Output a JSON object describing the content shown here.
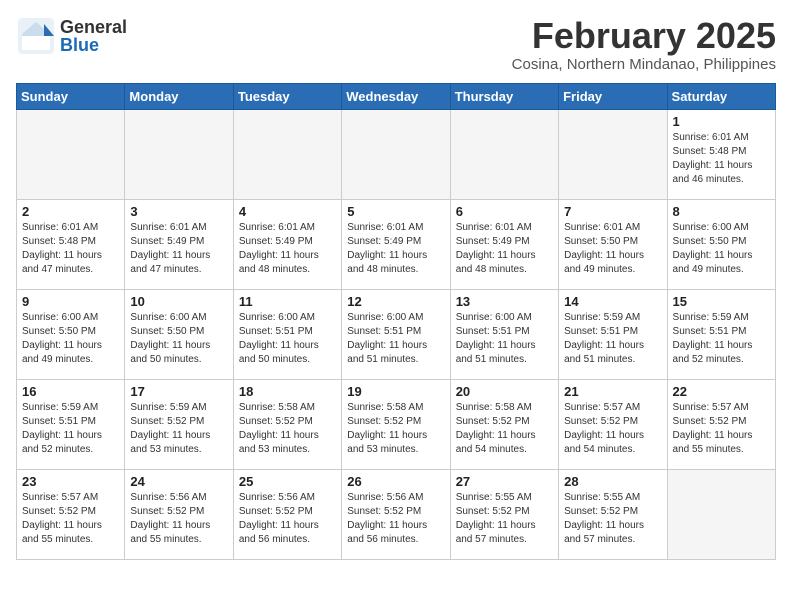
{
  "header": {
    "logo_general": "General",
    "logo_blue": "Blue",
    "month": "February 2025",
    "location": "Cosina, Northern Mindanao, Philippines"
  },
  "weekdays": [
    "Sunday",
    "Monday",
    "Tuesday",
    "Wednesday",
    "Thursday",
    "Friday",
    "Saturday"
  ],
  "weeks": [
    [
      {
        "day": "",
        "info": ""
      },
      {
        "day": "",
        "info": ""
      },
      {
        "day": "",
        "info": ""
      },
      {
        "day": "",
        "info": ""
      },
      {
        "day": "",
        "info": ""
      },
      {
        "day": "",
        "info": ""
      },
      {
        "day": "1",
        "info": "Sunrise: 6:01 AM\nSunset: 5:48 PM\nDaylight: 11 hours and 46 minutes."
      }
    ],
    [
      {
        "day": "2",
        "info": "Sunrise: 6:01 AM\nSunset: 5:48 PM\nDaylight: 11 hours and 47 minutes."
      },
      {
        "day": "3",
        "info": "Sunrise: 6:01 AM\nSunset: 5:49 PM\nDaylight: 11 hours and 47 minutes."
      },
      {
        "day": "4",
        "info": "Sunrise: 6:01 AM\nSunset: 5:49 PM\nDaylight: 11 hours and 48 minutes."
      },
      {
        "day": "5",
        "info": "Sunrise: 6:01 AM\nSunset: 5:49 PM\nDaylight: 11 hours and 48 minutes."
      },
      {
        "day": "6",
        "info": "Sunrise: 6:01 AM\nSunset: 5:49 PM\nDaylight: 11 hours and 48 minutes."
      },
      {
        "day": "7",
        "info": "Sunrise: 6:01 AM\nSunset: 5:50 PM\nDaylight: 11 hours and 49 minutes."
      },
      {
        "day": "8",
        "info": "Sunrise: 6:00 AM\nSunset: 5:50 PM\nDaylight: 11 hours and 49 minutes."
      }
    ],
    [
      {
        "day": "9",
        "info": "Sunrise: 6:00 AM\nSunset: 5:50 PM\nDaylight: 11 hours and 49 minutes."
      },
      {
        "day": "10",
        "info": "Sunrise: 6:00 AM\nSunset: 5:50 PM\nDaylight: 11 hours and 50 minutes."
      },
      {
        "day": "11",
        "info": "Sunrise: 6:00 AM\nSunset: 5:51 PM\nDaylight: 11 hours and 50 minutes."
      },
      {
        "day": "12",
        "info": "Sunrise: 6:00 AM\nSunset: 5:51 PM\nDaylight: 11 hours and 51 minutes."
      },
      {
        "day": "13",
        "info": "Sunrise: 6:00 AM\nSunset: 5:51 PM\nDaylight: 11 hours and 51 minutes."
      },
      {
        "day": "14",
        "info": "Sunrise: 5:59 AM\nSunset: 5:51 PM\nDaylight: 11 hours and 51 minutes."
      },
      {
        "day": "15",
        "info": "Sunrise: 5:59 AM\nSunset: 5:51 PM\nDaylight: 11 hours and 52 minutes."
      }
    ],
    [
      {
        "day": "16",
        "info": "Sunrise: 5:59 AM\nSunset: 5:51 PM\nDaylight: 11 hours and 52 minutes."
      },
      {
        "day": "17",
        "info": "Sunrise: 5:59 AM\nSunset: 5:52 PM\nDaylight: 11 hours and 53 minutes."
      },
      {
        "day": "18",
        "info": "Sunrise: 5:58 AM\nSunset: 5:52 PM\nDaylight: 11 hours and 53 minutes."
      },
      {
        "day": "19",
        "info": "Sunrise: 5:58 AM\nSunset: 5:52 PM\nDaylight: 11 hours and 53 minutes."
      },
      {
        "day": "20",
        "info": "Sunrise: 5:58 AM\nSunset: 5:52 PM\nDaylight: 11 hours and 54 minutes."
      },
      {
        "day": "21",
        "info": "Sunrise: 5:57 AM\nSunset: 5:52 PM\nDaylight: 11 hours and 54 minutes."
      },
      {
        "day": "22",
        "info": "Sunrise: 5:57 AM\nSunset: 5:52 PM\nDaylight: 11 hours and 55 minutes."
      }
    ],
    [
      {
        "day": "23",
        "info": "Sunrise: 5:57 AM\nSunset: 5:52 PM\nDaylight: 11 hours and 55 minutes."
      },
      {
        "day": "24",
        "info": "Sunrise: 5:56 AM\nSunset: 5:52 PM\nDaylight: 11 hours and 55 minutes."
      },
      {
        "day": "25",
        "info": "Sunrise: 5:56 AM\nSunset: 5:52 PM\nDaylight: 11 hours and 56 minutes."
      },
      {
        "day": "26",
        "info": "Sunrise: 5:56 AM\nSunset: 5:52 PM\nDaylight: 11 hours and 56 minutes."
      },
      {
        "day": "27",
        "info": "Sunrise: 5:55 AM\nSunset: 5:52 PM\nDaylight: 11 hours and 57 minutes."
      },
      {
        "day": "28",
        "info": "Sunrise: 5:55 AM\nSunset: 5:52 PM\nDaylight: 11 hours and 57 minutes."
      },
      {
        "day": "",
        "info": ""
      }
    ]
  ]
}
